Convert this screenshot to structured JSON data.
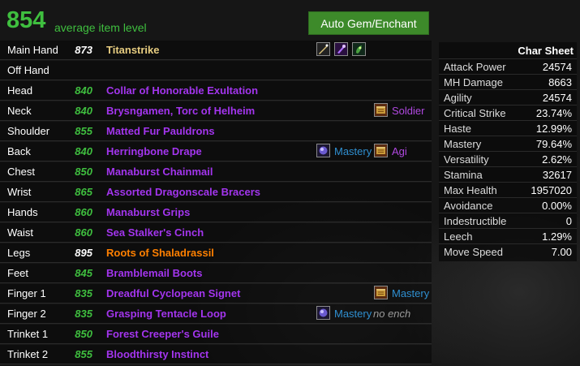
{
  "header": {
    "item_level": "854",
    "item_level_label": "average item level",
    "gem_button": "Auto Gem/Enchant"
  },
  "colors": {
    "green": "#3fbf3f",
    "epic": "#a335ee",
    "artifact": "#e6cc80",
    "legendary": "#ff8000",
    "enchant_blue": "#2f8fd0",
    "enchant_purple": "#b048e0"
  },
  "gear": [
    {
      "slot": "Main Hand",
      "level": "873",
      "name": "Titanstrike",
      "quality": "artifact",
      "relics": [
        "relic-1-icon",
        "relic-2-icon",
        "relic-3-icon"
      ]
    },
    {
      "slot": "Off Hand",
      "level": "",
      "name": "",
      "quality": "none"
    },
    {
      "slot": "Head",
      "level": "840",
      "name": "Collar of Honorable Exultation",
      "quality": "epic"
    },
    {
      "slot": "Neck",
      "level": "840",
      "name": "Brysngamen, Torc of Helheim",
      "quality": "epic",
      "enchant": {
        "icon": "enchant-scroll-icon",
        "text": "Soldier",
        "color": "purple"
      }
    },
    {
      "slot": "Shoulder",
      "level": "855",
      "name": "Matted Fur Pauldrons",
      "quality": "epic"
    },
    {
      "slot": "Back",
      "level": "840",
      "name": "Herringbone Drape",
      "quality": "epic",
      "gem": {
        "icon": "gem-icon",
        "text": "Mastery"
      },
      "enchant": {
        "icon": "enchant-scroll-icon",
        "text": "Agi",
        "color": "purple"
      }
    },
    {
      "slot": "Chest",
      "level": "850",
      "name": "Manaburst Chainmail",
      "quality": "epic"
    },
    {
      "slot": "Wrist",
      "level": "865",
      "name": "Assorted Dragonscale Bracers",
      "quality": "epic"
    },
    {
      "slot": "Hands",
      "level": "860",
      "name": "Manaburst Grips",
      "quality": "epic"
    },
    {
      "slot": "Waist",
      "level": "860",
      "name": "Sea Stalker's Cinch",
      "quality": "epic"
    },
    {
      "slot": "Legs",
      "level": "895",
      "name": "Roots of Shaladrassil",
      "quality": "legendary"
    },
    {
      "slot": "Feet",
      "level": "845",
      "name": "Bramblemail Boots",
      "quality": "epic"
    },
    {
      "slot": "Finger 1",
      "level": "835",
      "name": "Dreadful Cyclopean Signet",
      "quality": "epic",
      "enchant": {
        "icon": "enchant-scroll-icon",
        "text": "Mastery",
        "color": "blue"
      }
    },
    {
      "slot": "Finger 2",
      "level": "835",
      "name": "Grasping Tentacle Loop",
      "quality": "epic",
      "gem": {
        "icon": "gem-icon",
        "text": "Mastery"
      },
      "no_enchant": "no ench"
    },
    {
      "slot": "Trinket 1",
      "level": "850",
      "name": "Forest Creeper's Guile",
      "quality": "epic"
    },
    {
      "slot": "Trinket 2",
      "level": "855",
      "name": "Bloodthirsty Instinct",
      "quality": "epic"
    }
  ],
  "char_sheet": {
    "title": "Char Sheet",
    "stats": [
      {
        "name": "Attack Power",
        "value": "24574"
      },
      {
        "name": "MH Damage",
        "value": "8663"
      },
      {
        "name": "Agility",
        "value": "24574"
      },
      {
        "name": "Critical Strike",
        "value": "23.74%"
      },
      {
        "name": "Haste",
        "value": "12.99%"
      },
      {
        "name": "Mastery",
        "value": "79.64%"
      },
      {
        "name": "Versatility",
        "value": "2.62%"
      },
      {
        "name": "Stamina",
        "value": "32617"
      },
      {
        "name": "Max Health",
        "value": "1957020"
      },
      {
        "name": "Avoidance",
        "value": "0.00%"
      },
      {
        "name": "Indestructible",
        "value": "0"
      },
      {
        "name": "Leech",
        "value": "1.29%"
      },
      {
        "name": "Move Speed",
        "value": "7.00"
      }
    ]
  }
}
